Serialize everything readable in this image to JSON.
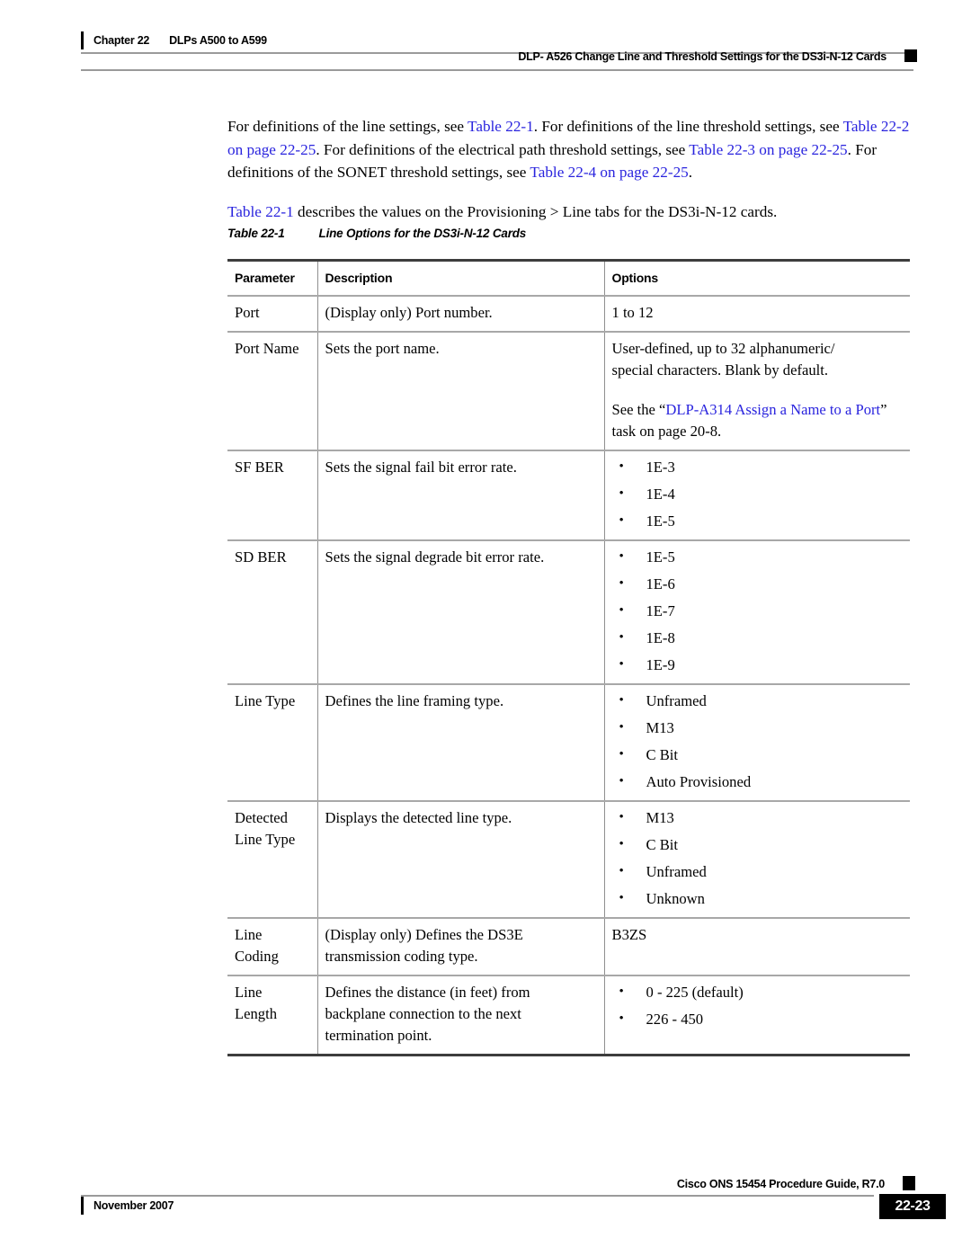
{
  "header": {
    "chapter": "Chapter 22",
    "chapter_subject": "DLPs A500 to A599",
    "doc_title": "DLP- A526 Change Line and Threshold Settings for the DS3i-N-12 Cards"
  },
  "body": {
    "paragraph_1": {
      "segments": [
        {
          "text": "For definitions of the line settings, see ",
          "link": false
        },
        {
          "text": "Table 22-1",
          "link": true
        },
        {
          "text": ". For definitions of the line threshold settings, see ",
          "link": false
        },
        {
          "text": "Table 22-2 on page 22-25",
          "link": true
        },
        {
          "text": ". For definitions of the electrical path threshold settings, see ",
          "link": false
        },
        {
          "text": "Table 22-3 on page 22-25",
          "link": true
        },
        {
          "text": ". For definitions of the SONET threshold settings, see ",
          "link": false
        },
        {
          "text": "Table 22-4 on page 22-25",
          "link": true
        },
        {
          "text": ".",
          "link": false
        }
      ]
    },
    "paragraph_2": {
      "segments": [
        {
          "text": "Table 22-1",
          "link": true
        },
        {
          "text": " describes the values on the Provisioning > Line tabs for the DS3i-N-12 cards.",
          "link": false
        }
      ]
    }
  },
  "table": {
    "caption_number": "Table 22-1",
    "caption_title": "Line Options for the DS3i-N-12 Cards",
    "columns": [
      "Parameter",
      "Description",
      "Options"
    ],
    "rows": [
      {
        "parameter": "Port",
        "description": [
          "(Display only) Port number."
        ],
        "options_plain": [
          "1 to 12"
        ],
        "options_bullets": []
      },
      {
        "parameter": "Port Name",
        "description": [
          "Sets the port name."
        ],
        "options_plain": [
          "User-defined, up to 32 alphanumeric/",
          "special characters. Blank by default."
        ],
        "options_bullets": [],
        "options_note_segments": [
          {
            "text": "See the “",
            "link": false
          },
          {
            "text": "DLP-A314 Assign a Name to a Port",
            "link": true
          },
          {
            "text": "” task on ",
            "link": false
          },
          {
            "text": "page 20-8",
            "link": false
          },
          {
            "text": ".",
            "link": false
          }
        ]
      },
      {
        "parameter": "SF BER",
        "description": [
          "Sets the signal fail bit error rate."
        ],
        "options_plain": [],
        "options_bullets": [
          "1E-3",
          "1E-4",
          "1E-5"
        ]
      },
      {
        "parameter": "SD BER",
        "description": [
          "Sets the signal degrade bit error rate."
        ],
        "options_plain": [],
        "options_bullets": [
          "1E-5",
          "1E-6",
          "1E-7",
          "1E-8",
          "1E-9"
        ]
      },
      {
        "parameter": "Line Type",
        "description": [
          "Defines the line framing type."
        ],
        "options_plain": [],
        "options_bullets": [
          "Unframed",
          "M13",
          "C Bit",
          "Auto Provisioned"
        ]
      },
      {
        "parameter": "Detected Line Type",
        "parameter_lines": [
          "Detected",
          "Line Type"
        ],
        "description": [
          "Displays the detected line type."
        ],
        "options_plain": [],
        "options_bullets": [
          "M13",
          "C Bit",
          "Unframed",
          "Unknown"
        ]
      },
      {
        "parameter": "Line Coding",
        "parameter_lines": [
          "Line",
          "Coding"
        ],
        "description": [
          "(Display only) Defines the DS3E",
          "transmission coding type."
        ],
        "options_plain": [
          "B3ZS"
        ],
        "options_bullets": []
      },
      {
        "parameter": "Line Length",
        "parameter_lines": [
          "Line",
          "Length"
        ],
        "description": [
          "Defines the distance (in feet) from",
          "backplane connection to the next",
          "termination point."
        ],
        "options_plain": [],
        "options_bullets": [
          "0 - 225 (default)",
          "226 - 450"
        ]
      }
    ]
  },
  "footer": {
    "guide_title": "Cisco ONS 15454 Procedure Guide, R7.0",
    "date": "November 2007",
    "page_number": "22-23"
  },
  "colors": {
    "link": "#2a24de",
    "rule_thick": "#3d3d3d",
    "rule_thin": "#a8a8a8",
    "header_rule": "#9a9a9a"
  }
}
